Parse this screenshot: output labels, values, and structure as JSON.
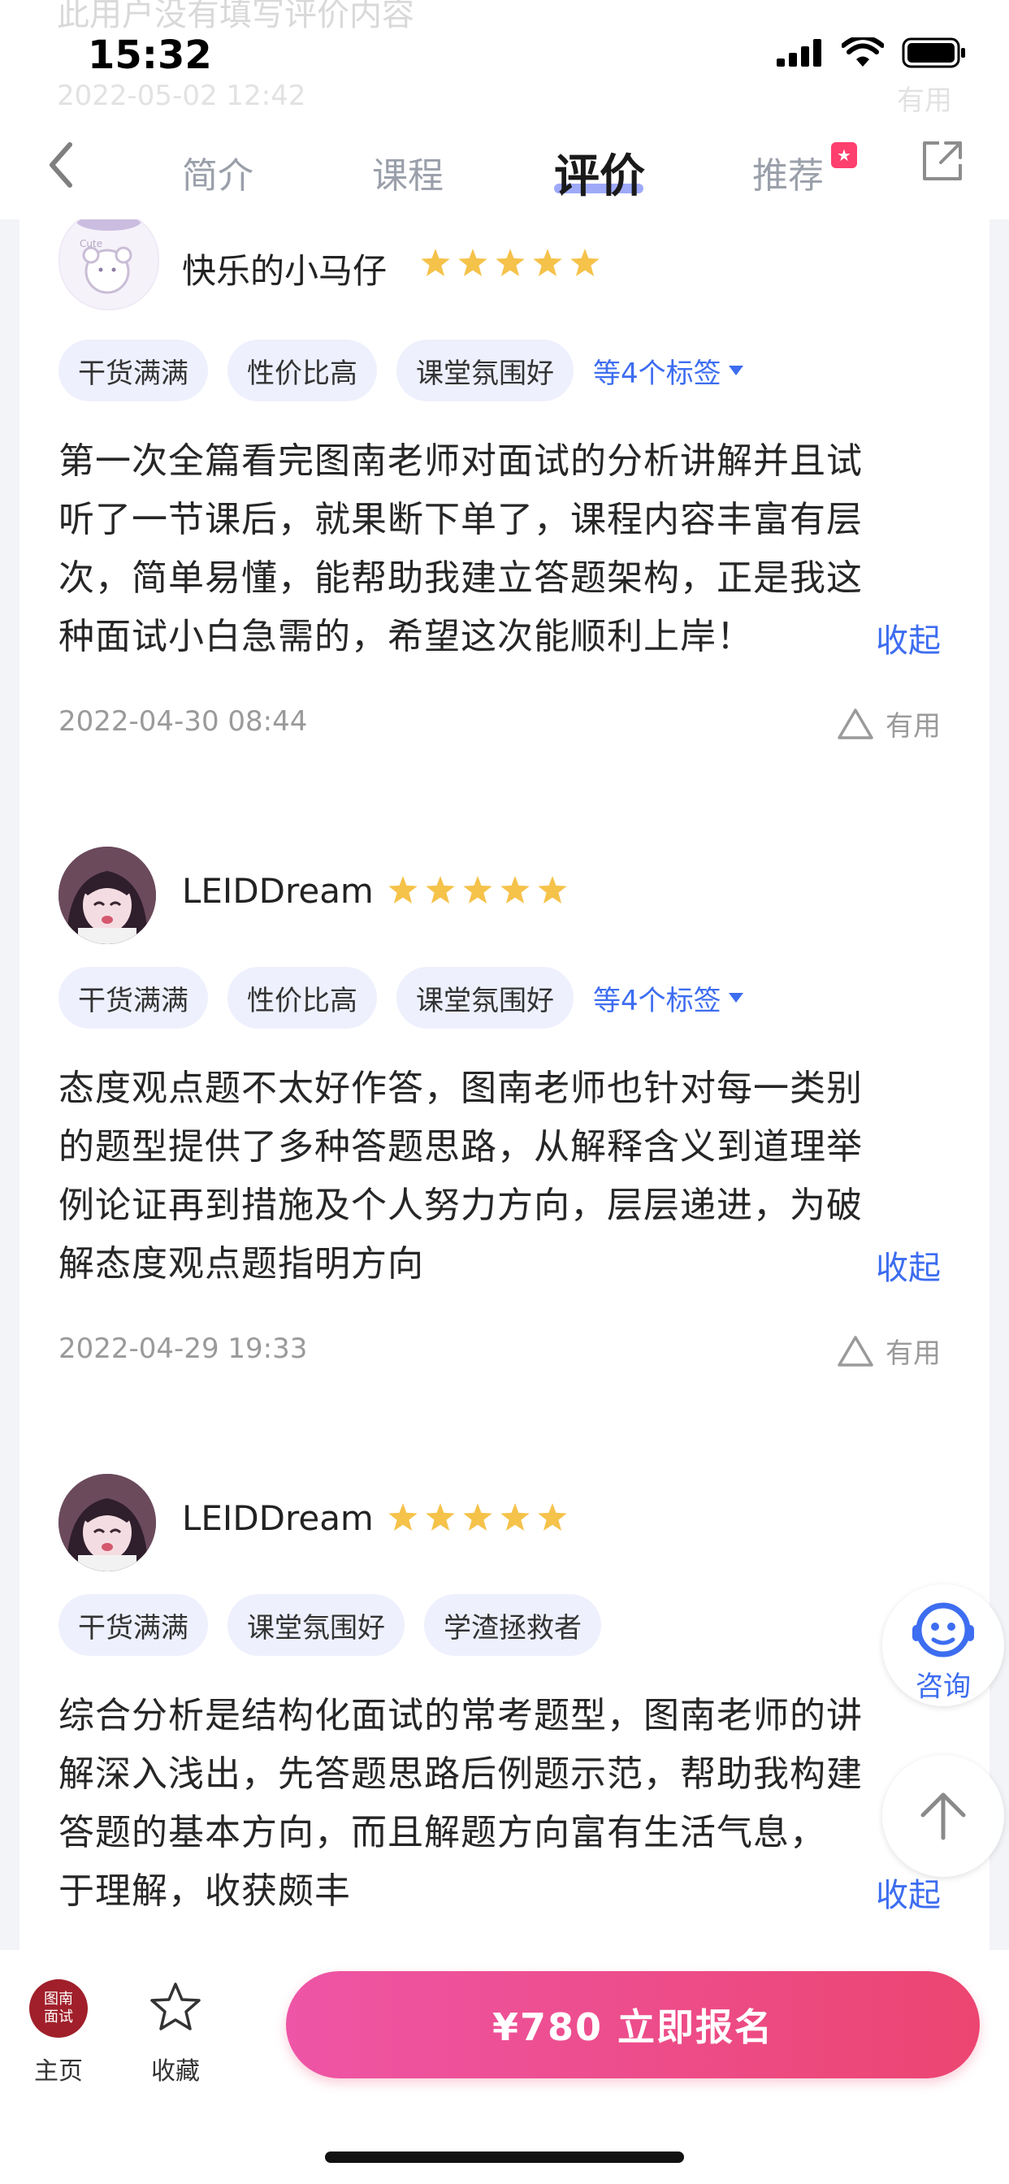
{
  "status_bar": {
    "time": "15:32"
  },
  "ghost_review": {
    "text": "此用户没有填写评价内容",
    "date": "2022-05-02 12:42",
    "useful": "有用"
  },
  "tabs": {
    "items": [
      "简介",
      "课程",
      "评价",
      "推荐"
    ],
    "active": "评价"
  },
  "reviews": [
    {
      "name": "快乐的小马仔",
      "avatar": "cute-bear-avatar",
      "rating": 5,
      "tags": [
        "干货满满",
        "性价比高",
        "课堂氛围好"
      ],
      "more_tags": "等4个标签",
      "lines": [
        "第一次全篇看完图南老师对面试的分析讲解并且试",
        "听了一节课后，就果断下单了，课程内容丰富有层",
        "次，简单易懂，能帮助我建立答题架构，正是我这",
        "种面试小白急需的，希望这次能顺利上岸！"
      ],
      "collapse": "收起",
      "date": "2022-04-30 08:44",
      "useful": "有用"
    },
    {
      "name": "LEIDDream",
      "avatar": "anime-girl-avatar",
      "rating": 5,
      "tags": [
        "干货满满",
        "性价比高",
        "课堂氛围好"
      ],
      "more_tags": "等4个标签",
      "lines": [
        "态度观点题不太好作答，图南老师也针对每一类别",
        "的题型提供了多种答题思路，从解释含义到道理举",
        "例论证再到措施及个人努力方向，层层递进，为破",
        "解态度观点题指明方向"
      ],
      "collapse": "收起",
      "date": "2022-04-29 19:33",
      "useful": "有用"
    },
    {
      "name": "LEIDDream",
      "avatar": "anime-girl-avatar",
      "rating": 5,
      "tags": [
        "干货满满",
        "课堂氛围好",
        "学渣拯救者"
      ],
      "more_tags": "",
      "lines": [
        "综合分析是结构化面试的常考题型，图南老师的讲",
        "解深入浅出，先答题思路后例题示范，帮助我构建",
        "答题的基本方向，而且解题方向富有生活气息，",
        "于理解，收获颇丰"
      ],
      "collapse": "收起",
      "date": "",
      "useful": ""
    }
  ],
  "floating": {
    "consult_label": "咨询"
  },
  "bottom_bar": {
    "logo_text": "图南面试",
    "home_label": "主页",
    "favorite_label": "收藏",
    "enroll_label": "¥780 立即报名"
  },
  "colors": {
    "accent_blue": "#3d6df0",
    "star_yellow": "#f5c24a",
    "enroll_pink": "#ec4571",
    "tag_bg": "#eef0fd"
  }
}
